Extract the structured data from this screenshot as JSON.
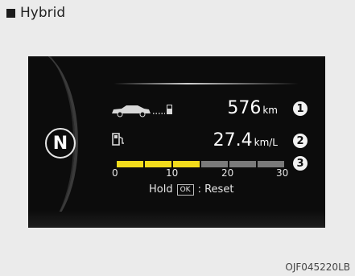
{
  "header": {
    "title": "Hybrid"
  },
  "cluster": {
    "gear": "N",
    "range": {
      "value": "576",
      "unit": "km",
      "callout": "1"
    },
    "fuel_economy": {
      "value": "27.4",
      "unit": "km/L",
      "callout": "2"
    },
    "bar": {
      "callout": "3",
      "fill_fraction": 0.5,
      "ticks": [
        "0",
        "10",
        "20",
        "30"
      ]
    },
    "hold_text": "Hold",
    "ok_label": "OK",
    "reset_text": ": Reset"
  },
  "footer": {
    "code": "OJF045220LB"
  },
  "colors": {
    "bar_fill": "#f2dc1c",
    "bar_bg": "#7a7a7a",
    "display_bg": "#0c0c0c"
  },
  "icons": {
    "car": "car-icon",
    "pump": "fuel-pump-icon"
  }
}
